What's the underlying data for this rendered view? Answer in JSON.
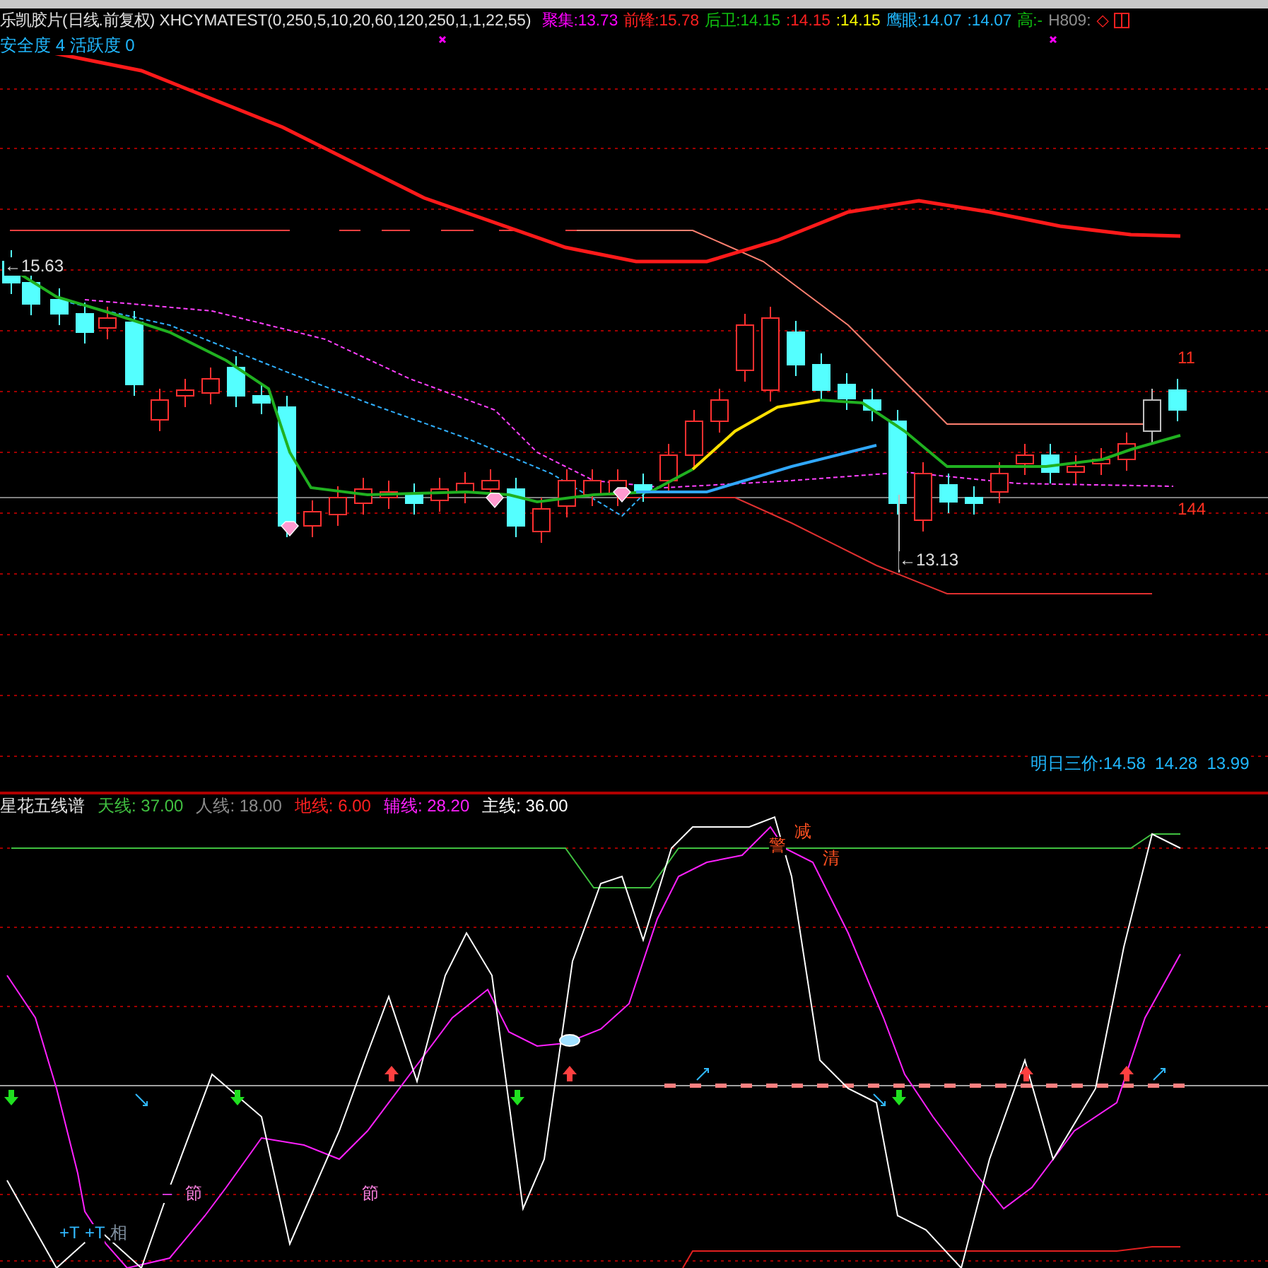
{
  "main_chart": {
    "title": "乐凯胶片(日线.前复权) XHCYMATEST(0,250,5,10,20,60,120,250,1,1,22,55)",
    "legend": [
      {
        "text": "聚集:13.73",
        "color": "#ff00ff"
      },
      {
        "text": "前锋:15.78",
        "color": "#ff2020"
      },
      {
        "text": "后卫:14.15",
        "color": "#10c010"
      },
      {
        "text": ":14.15",
        "color": "#ff2020"
      },
      {
        "text": ":14.15",
        "color": "#ffff00"
      },
      {
        "text": "鹰眼:14.07",
        "color": "#20b8ff"
      },
      {
        "text": ":14.07",
        "color": "#20b8ff"
      },
      {
        "text": "高:-",
        "color": "#10c010"
      },
      {
        "text": "H809:",
        "color": "#909090"
      },
      {
        "text": "◇",
        "color": "#ff2020"
      }
    ],
    "status_line": "安全度 4 活跃度 0",
    "price_labels": [
      "←15.63",
      "←13.13",
      "11",
      "144"
    ],
    "forecast": "明日三价:14.58  14.28  13.99"
  },
  "indicator": {
    "title": "星花五线谱",
    "legend": [
      {
        "text": "天线: 37.00",
        "color": "#40c040"
      },
      {
        "text": "人线: 18.00",
        "color": "#8c8c8c"
      },
      {
        "text": "地线: 6.00",
        "color": "#ff2020"
      },
      {
        "text": "辅线: 28.20",
        "color": "#ff20ff"
      },
      {
        "text": "主线: 36.00",
        "color": "#ffffff"
      }
    ],
    "signals": [
      "–",
      "節",
      "節",
      "+T",
      "+T",
      "相",
      "减",
      "警",
      "清"
    ]
  }
}
